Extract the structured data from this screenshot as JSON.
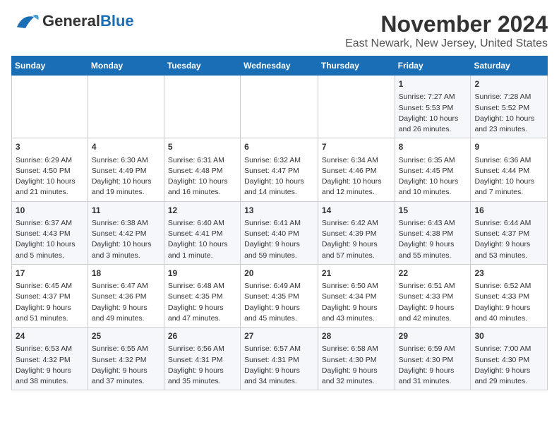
{
  "header": {
    "logo_general": "General",
    "logo_blue": "Blue",
    "title": "November 2024",
    "subtitle": "East Newark, New Jersey, United States"
  },
  "days_of_week": [
    "Sunday",
    "Monday",
    "Tuesday",
    "Wednesday",
    "Thursday",
    "Friday",
    "Saturday"
  ],
  "weeks": [
    [
      {
        "day": "",
        "content": ""
      },
      {
        "day": "",
        "content": ""
      },
      {
        "day": "",
        "content": ""
      },
      {
        "day": "",
        "content": ""
      },
      {
        "day": "",
        "content": ""
      },
      {
        "day": "1",
        "content": "Sunrise: 7:27 AM\nSunset: 5:53 PM\nDaylight: 10 hours\nand 26 minutes."
      },
      {
        "day": "2",
        "content": "Sunrise: 7:28 AM\nSunset: 5:52 PM\nDaylight: 10 hours\nand 23 minutes."
      }
    ],
    [
      {
        "day": "3",
        "content": "Sunrise: 6:29 AM\nSunset: 4:50 PM\nDaylight: 10 hours\nand 21 minutes."
      },
      {
        "day": "4",
        "content": "Sunrise: 6:30 AM\nSunset: 4:49 PM\nDaylight: 10 hours\nand 19 minutes."
      },
      {
        "day": "5",
        "content": "Sunrise: 6:31 AM\nSunset: 4:48 PM\nDaylight: 10 hours\nand 16 minutes."
      },
      {
        "day": "6",
        "content": "Sunrise: 6:32 AM\nSunset: 4:47 PM\nDaylight: 10 hours\nand 14 minutes."
      },
      {
        "day": "7",
        "content": "Sunrise: 6:34 AM\nSunset: 4:46 PM\nDaylight: 10 hours\nand 12 minutes."
      },
      {
        "day": "8",
        "content": "Sunrise: 6:35 AM\nSunset: 4:45 PM\nDaylight: 10 hours\nand 10 minutes."
      },
      {
        "day": "9",
        "content": "Sunrise: 6:36 AM\nSunset: 4:44 PM\nDaylight: 10 hours\nand 7 minutes."
      }
    ],
    [
      {
        "day": "10",
        "content": "Sunrise: 6:37 AM\nSunset: 4:43 PM\nDaylight: 10 hours\nand 5 minutes."
      },
      {
        "day": "11",
        "content": "Sunrise: 6:38 AM\nSunset: 4:42 PM\nDaylight: 10 hours\nand 3 minutes."
      },
      {
        "day": "12",
        "content": "Sunrise: 6:40 AM\nSunset: 4:41 PM\nDaylight: 10 hours\nand 1 minute."
      },
      {
        "day": "13",
        "content": "Sunrise: 6:41 AM\nSunset: 4:40 PM\nDaylight: 9 hours\nand 59 minutes."
      },
      {
        "day": "14",
        "content": "Sunrise: 6:42 AM\nSunset: 4:39 PM\nDaylight: 9 hours\nand 57 minutes."
      },
      {
        "day": "15",
        "content": "Sunrise: 6:43 AM\nSunset: 4:38 PM\nDaylight: 9 hours\nand 55 minutes."
      },
      {
        "day": "16",
        "content": "Sunrise: 6:44 AM\nSunset: 4:37 PM\nDaylight: 9 hours\nand 53 minutes."
      }
    ],
    [
      {
        "day": "17",
        "content": "Sunrise: 6:45 AM\nSunset: 4:37 PM\nDaylight: 9 hours\nand 51 minutes."
      },
      {
        "day": "18",
        "content": "Sunrise: 6:47 AM\nSunset: 4:36 PM\nDaylight: 9 hours\nand 49 minutes."
      },
      {
        "day": "19",
        "content": "Sunrise: 6:48 AM\nSunset: 4:35 PM\nDaylight: 9 hours\nand 47 minutes."
      },
      {
        "day": "20",
        "content": "Sunrise: 6:49 AM\nSunset: 4:35 PM\nDaylight: 9 hours\nand 45 minutes."
      },
      {
        "day": "21",
        "content": "Sunrise: 6:50 AM\nSunset: 4:34 PM\nDaylight: 9 hours\nand 43 minutes."
      },
      {
        "day": "22",
        "content": "Sunrise: 6:51 AM\nSunset: 4:33 PM\nDaylight: 9 hours\nand 42 minutes."
      },
      {
        "day": "23",
        "content": "Sunrise: 6:52 AM\nSunset: 4:33 PM\nDaylight: 9 hours\nand 40 minutes."
      }
    ],
    [
      {
        "day": "24",
        "content": "Sunrise: 6:53 AM\nSunset: 4:32 PM\nDaylight: 9 hours\nand 38 minutes."
      },
      {
        "day": "25",
        "content": "Sunrise: 6:55 AM\nSunset: 4:32 PM\nDaylight: 9 hours\nand 37 minutes."
      },
      {
        "day": "26",
        "content": "Sunrise: 6:56 AM\nSunset: 4:31 PM\nDaylight: 9 hours\nand 35 minutes."
      },
      {
        "day": "27",
        "content": "Sunrise: 6:57 AM\nSunset: 4:31 PM\nDaylight: 9 hours\nand 34 minutes."
      },
      {
        "day": "28",
        "content": "Sunrise: 6:58 AM\nSunset: 4:30 PM\nDaylight: 9 hours\nand 32 minutes."
      },
      {
        "day": "29",
        "content": "Sunrise: 6:59 AM\nSunset: 4:30 PM\nDaylight: 9 hours\nand 31 minutes."
      },
      {
        "day": "30",
        "content": "Sunrise: 7:00 AM\nSunset: 4:30 PM\nDaylight: 9 hours\nand 29 minutes."
      }
    ]
  ]
}
